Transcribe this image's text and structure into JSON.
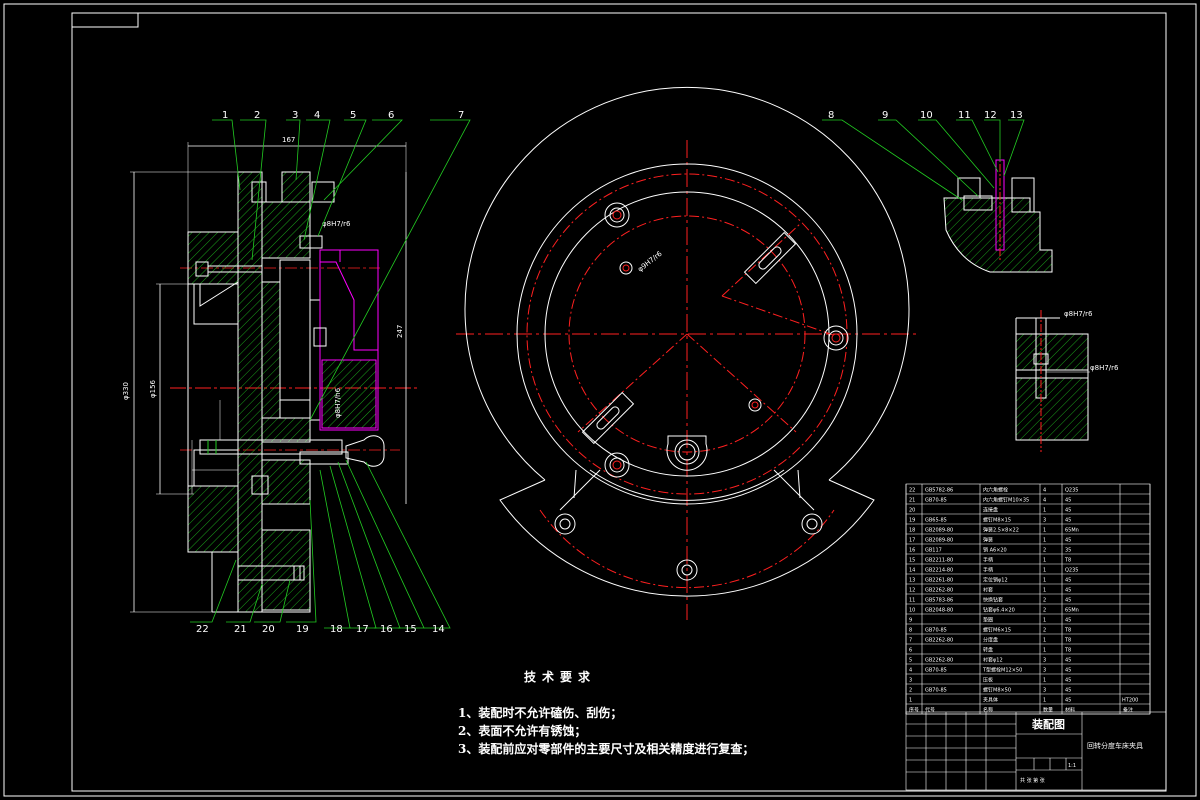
{
  "drawing": {
    "colors": {
      "background": "#000000",
      "outline": "#ffffff",
      "center": "#ff2020",
      "hatch": "#22cc22",
      "leader": "#22cc22",
      "magenta": "#ff00ff"
    },
    "callouts_top": [
      "1",
      "2",
      "3",
      "4",
      "5",
      "6",
      "7"
    ],
    "callouts_bottom": [
      "22",
      "21",
      "20",
      "19",
      "18",
      "17",
      "16",
      "15",
      "14"
    ],
    "callouts_detail": [
      "8",
      "9",
      "10",
      "11",
      "12",
      "13"
    ],
    "dimensions": {
      "overall_height": "φ330",
      "inner": "φ156",
      "right_height": "247",
      "top_width": "167",
      "fit_a": "φ8H7/r6",
      "fit_b": "φ8H7/h6",
      "fit_c": "φ9H7/r6",
      "fit_d": "φ8H7/r6"
    }
  },
  "requirements": {
    "title": "技术要求",
    "items": [
      "1、装配时不允许磕伤、刮伤；",
      "2、表面不允许有锈蚀；",
      "3、装配前应对零部件的主要尺寸及相关精度进行复查；"
    ]
  },
  "title_block": {
    "drawing_name": "装配图",
    "subtitle": "回转分度车床夹具",
    "footer": "共    张  第    张",
    "scale": "1:1"
  },
  "parts_list": {
    "rows": [
      {
        "no": "22",
        "std": "GB5782-86",
        "name": "内六角螺栓",
        "qty": "4",
        "mat": "Q235"
      },
      {
        "no": "21",
        "std": "GB70-85",
        "name": "内六角螺钉M10×35",
        "qty": "4",
        "mat": "45"
      },
      {
        "no": "20",
        "std": "",
        "name": "连接盘",
        "qty": "1",
        "mat": "45"
      },
      {
        "no": "19",
        "std": "GB65-85",
        "name": "螺钉M8×15",
        "qty": "3",
        "mat": "45"
      },
      {
        "no": "18",
        "std": "GB2089-80",
        "name": "弹簧2.5×8×22",
        "qty": "1",
        "mat": "65Mn"
      },
      {
        "no": "17",
        "std": "GB2089-80",
        "name": "弹簧",
        "qty": "1",
        "mat": "45"
      },
      {
        "no": "16",
        "std": "GB117",
        "name": "销 A6×20",
        "qty": "2",
        "mat": "35"
      },
      {
        "no": "15",
        "std": "GB2211-80",
        "name": "手柄",
        "qty": "1",
        "mat": "T8"
      },
      {
        "no": "14",
        "std": "GB2214-80",
        "name": "手柄",
        "qty": "1",
        "mat": "Q235"
      },
      {
        "no": "13",
        "std": "GB2261-80",
        "name": "定位销φ12",
        "qty": "1",
        "mat": "45"
      },
      {
        "no": "12",
        "std": "GB2262-80",
        "name": "衬套",
        "qty": "1",
        "mat": "45"
      },
      {
        "no": "11",
        "std": "GB5783-86",
        "name": "快换钻套",
        "qty": "2",
        "mat": "45"
      },
      {
        "no": "10",
        "std": "GB2048-80",
        "name": "钻套φ6.4×20",
        "qty": "2",
        "mat": "65Mn"
      },
      {
        "no": "9",
        "std": "",
        "name": "垫圈",
        "qty": "1",
        "mat": "45"
      },
      {
        "no": "8",
        "std": "GB70-85",
        "name": "螺钉M6×15",
        "qty": "2",
        "mat": "T8"
      },
      {
        "no": "7",
        "std": "GB2262-80",
        "name": "分度盘",
        "qty": "1",
        "mat": "T8"
      },
      {
        "no": "6",
        "std": "",
        "name": "转盘",
        "qty": "1",
        "mat": "T8"
      },
      {
        "no": "5",
        "std": "GB2262-80",
        "name": "衬套φ12",
        "qty": "3",
        "mat": "45"
      },
      {
        "no": "4",
        "std": "GB70-85",
        "name": "T型螺栓M12×50",
        "qty": "3",
        "mat": "45"
      },
      {
        "no": "3",
        "std": "",
        "name": "压板",
        "qty": "1",
        "mat": "45"
      },
      {
        "no": "2",
        "std": "GB70-85",
        "name": "螺钉M8×50",
        "qty": "3",
        "mat": "45"
      },
      {
        "no": "1",
        "std": "",
        "name": "夹具体",
        "qty": "1",
        "mat": "45"
      }
    ],
    "header": {
      "no": "序号",
      "std": "代号",
      "name": "名称",
      "qty": "数量",
      "mat": "材料",
      "note": "备注"
    },
    "side_note": "HT200"
  }
}
